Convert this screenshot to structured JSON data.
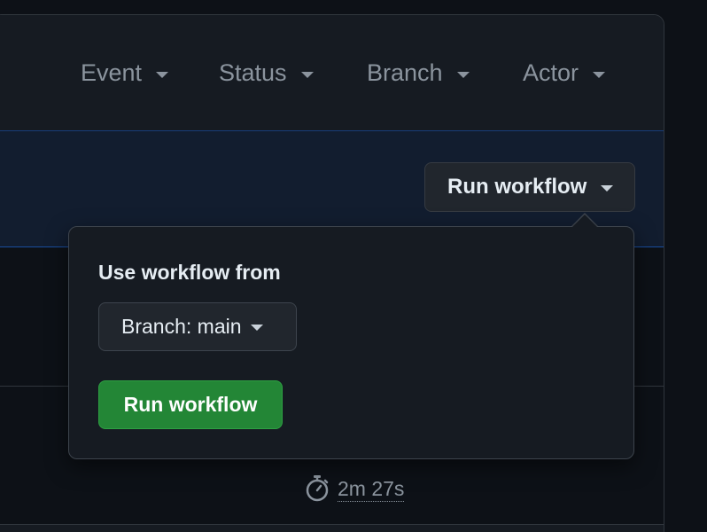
{
  "filters": {
    "event": "Event",
    "status": "Status",
    "branch": "Branch",
    "actor": "Actor"
  },
  "banner": {
    "run_workflow_label": "Run workflow"
  },
  "run": {
    "duration": "2m 27s"
  },
  "popup": {
    "title": "Use workflow from",
    "branch_select": "Branch: main",
    "submit_label": "Run workflow"
  },
  "colors": {
    "primary_button": "#238636",
    "background": "#0d1117",
    "surface": "#161b22"
  }
}
